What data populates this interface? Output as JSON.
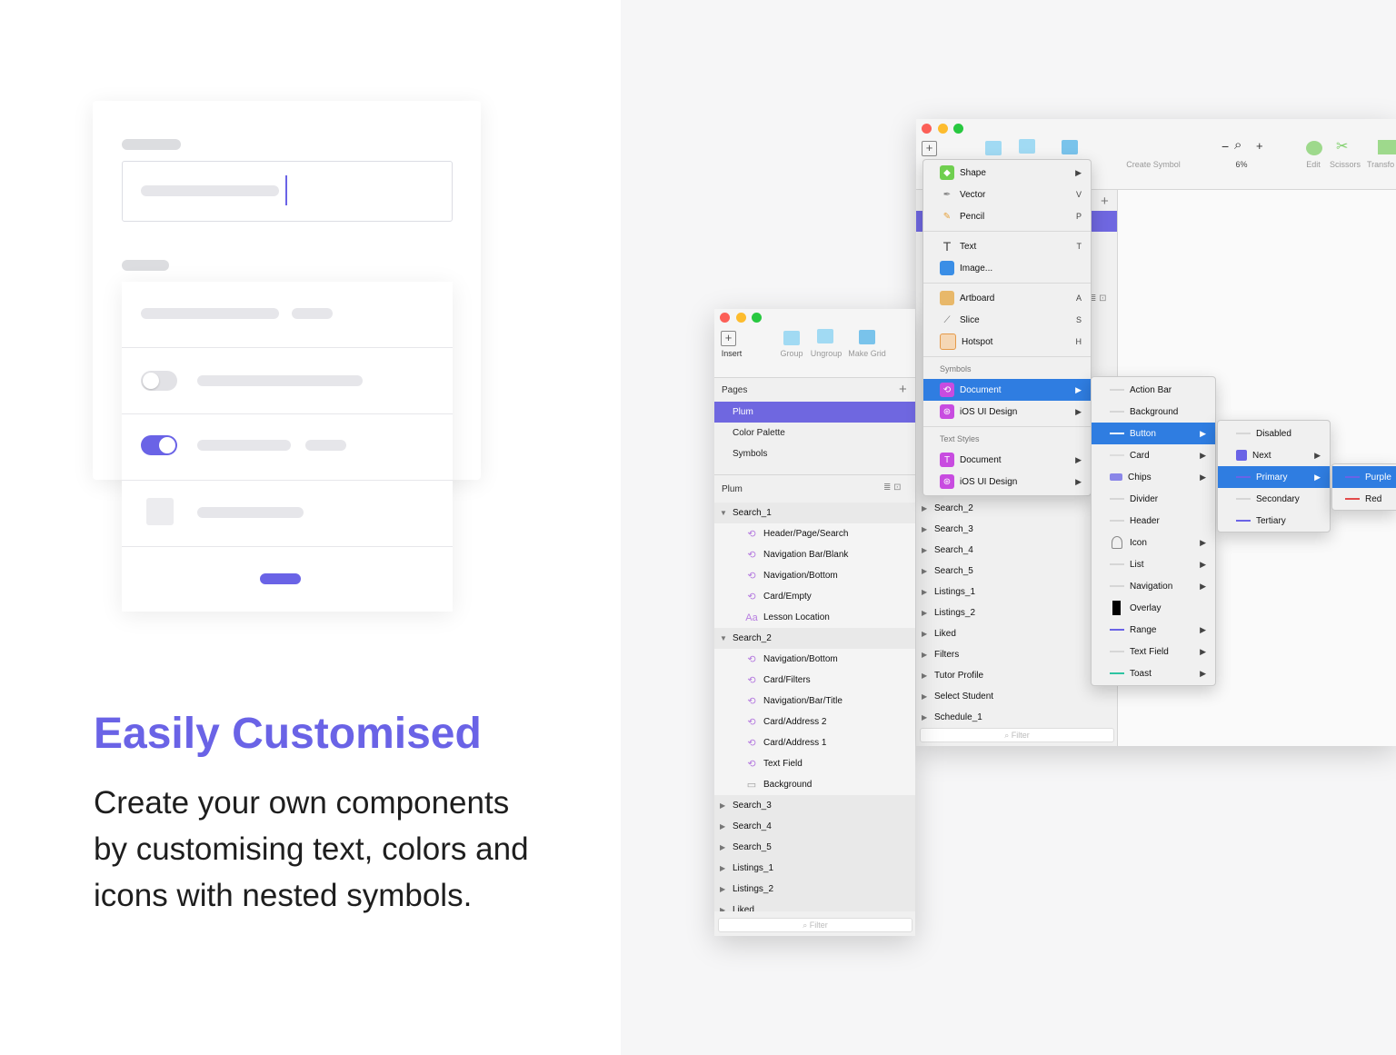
{
  "headline": "Easily Customised",
  "description": "Create your own components by customising text, colors and icons with nested symbols.",
  "colors": {
    "accent": "#6a63e6",
    "selection": "#2f7de1",
    "page_selection": "#6f67e0"
  },
  "small_window": {
    "toolbar": {
      "insert": "Insert",
      "group": "Group",
      "ungroup": "Ungroup",
      "make_grid": "Make Grid"
    },
    "pages_title": "Pages",
    "pages": [
      "Plum",
      "Color Palette",
      "Symbols"
    ],
    "layers_title": "Plum",
    "layers": [
      {
        "label": "Search_1",
        "level": 0,
        "open": true
      },
      {
        "label": "Header/Page/Search",
        "level": 1,
        "icon": "symbol-icon"
      },
      {
        "label": "Navigation Bar/Blank",
        "level": 1,
        "icon": "symbol-icon"
      },
      {
        "label": "Navigation/Bottom",
        "level": 1,
        "icon": "symbol-icon"
      },
      {
        "label": "Card/Empty",
        "level": 1,
        "icon": "symbol-icon"
      },
      {
        "label": "Lesson Location",
        "level": 1,
        "icon": "text-style-icon"
      },
      {
        "label": "Search_2",
        "level": 0,
        "open": true
      },
      {
        "label": "Navigation/Bottom",
        "level": 1,
        "icon": "symbol-icon"
      },
      {
        "label": "Card/Filters",
        "level": 1,
        "icon": "symbol-icon"
      },
      {
        "label": "Navigation/Bar/Title",
        "level": 1,
        "icon": "symbol-icon"
      },
      {
        "label": "Card/Address 2",
        "level": 1,
        "icon": "symbol-icon"
      },
      {
        "label": "Card/Address 1",
        "level": 1,
        "icon": "symbol-icon"
      },
      {
        "label": "Text Field",
        "level": 1,
        "icon": "symbol-icon"
      },
      {
        "label": "Background",
        "level": 1,
        "icon": "rectangle-icon"
      },
      {
        "label": "Search_3",
        "level": 0
      },
      {
        "label": "Search_4",
        "level": 0
      },
      {
        "label": "Search_5",
        "level": 0
      },
      {
        "label": "Listings_1",
        "level": 0
      },
      {
        "label": "Listings_2",
        "level": 0
      },
      {
        "label": "Liked",
        "level": 0
      }
    ],
    "filter_placeholder": "Filter"
  },
  "large_window": {
    "toolbar": {
      "create_symbol": "Create Symbol",
      "zoom": "6%",
      "edit": "Edit",
      "scissors": "Scissors",
      "transform": "Transfo"
    },
    "layers": [
      "Search_2",
      "Search_3",
      "Search_4",
      "Search_5",
      "Listings_1",
      "Listings_2",
      "Liked",
      "Filters",
      "Tutor Profile",
      "Select Student",
      "Schedule_1"
    ],
    "filter_placeholder": "Filter"
  },
  "insert_menu": {
    "group1": [
      {
        "label": "Shape",
        "shortcut": "▶",
        "icon": "shape-icon"
      },
      {
        "label": "Vector",
        "shortcut": "V",
        "icon": "vector-icon"
      },
      {
        "label": "Pencil",
        "shortcut": "P",
        "icon": "pencil-icon"
      }
    ],
    "group2": [
      {
        "label": "Text",
        "shortcut": "T",
        "icon": "text-icon"
      },
      {
        "label": "Image...",
        "shortcut": "",
        "icon": "image-icon"
      }
    ],
    "group3": [
      {
        "label": "Artboard",
        "shortcut": "A",
        "icon": "artboard-icon"
      },
      {
        "label": "Slice",
        "shortcut": "S",
        "icon": "slice-icon"
      },
      {
        "label": "Hotspot",
        "shortcut": "H",
        "icon": "hotspot-icon"
      }
    ],
    "symbols_header": "Symbols",
    "symbols": [
      {
        "label": "Document",
        "shortcut": "▶",
        "selected": true
      },
      {
        "label": "iOS UI Design",
        "shortcut": "▶"
      }
    ],
    "text_styles_header": "Text Styles",
    "text_styles": [
      {
        "label": "Document",
        "shortcut": "▶"
      },
      {
        "label": "iOS UI Design",
        "shortcut": "▶"
      }
    ]
  },
  "symbol_menu": [
    {
      "label": "Action Bar",
      "arrow": ""
    },
    {
      "label": "Background",
      "arrow": ""
    },
    {
      "label": "Button",
      "arrow": "▶",
      "selected": true
    },
    {
      "label": "Card",
      "arrow": "▶"
    },
    {
      "label": "Chips",
      "arrow": "▶"
    },
    {
      "label": "Divider",
      "arrow": ""
    },
    {
      "label": "Header",
      "arrow": ""
    },
    {
      "label": "Icon",
      "arrow": "▶"
    },
    {
      "label": "List",
      "arrow": "▶"
    },
    {
      "label": "Navigation",
      "arrow": "▶"
    },
    {
      "label": "Overlay",
      "arrow": ""
    },
    {
      "label": "Range",
      "arrow": "▶"
    },
    {
      "label": "Text Field",
      "arrow": "▶"
    },
    {
      "label": "Toast",
      "arrow": "▶"
    }
  ],
  "button_menu": [
    {
      "label": "Disabled",
      "arrow": ""
    },
    {
      "label": "Next",
      "arrow": "▶"
    },
    {
      "label": "Primary",
      "arrow": "▶",
      "selected": true
    },
    {
      "label": "Secondary",
      "arrow": ""
    },
    {
      "label": "Tertiary",
      "arrow": ""
    }
  ],
  "primary_menu": [
    {
      "label": "Purple",
      "selected": true
    },
    {
      "label": "Red"
    }
  ]
}
